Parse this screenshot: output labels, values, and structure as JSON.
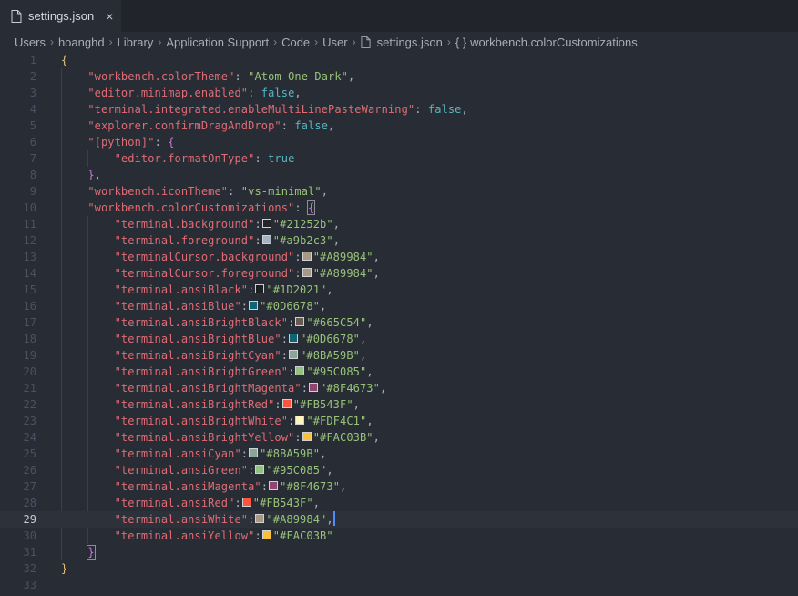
{
  "tab": {
    "title": "settings.json",
    "close": "×"
  },
  "breadcrumb": [
    "Users",
    "hoanghd",
    "Library",
    "Application Support",
    "Code",
    "User",
    "settings.json",
    "workbench.colorCustomizations"
  ],
  "breadcrumb_braces": "{ }",
  "current_line": 29,
  "lines": [
    {
      "n": "1",
      "ind": 0,
      "parts": [
        {
          "t": "{",
          "c": "brace1"
        }
      ]
    },
    {
      "n": "2",
      "ind": 1,
      "parts": [
        {
          "t": "\"workbench.colorTheme\"",
          "c": "key"
        },
        {
          "t": ": ",
          "c": "punc"
        },
        {
          "t": "\"Atom One Dark\"",
          "c": "str"
        },
        {
          "t": ",",
          "c": "punc"
        }
      ]
    },
    {
      "n": "3",
      "ind": 1,
      "parts": [
        {
          "t": "\"editor.minimap.enabled\"",
          "c": "key"
        },
        {
          "t": ": ",
          "c": "punc"
        },
        {
          "t": "false",
          "c": "bool"
        },
        {
          "t": ",",
          "c": "punc"
        }
      ]
    },
    {
      "n": "4",
      "ind": 1,
      "parts": [
        {
          "t": "\"terminal.integrated.enableMultiLinePasteWarning\"",
          "c": "key"
        },
        {
          "t": ": ",
          "c": "punc"
        },
        {
          "t": "false",
          "c": "bool"
        },
        {
          "t": ",",
          "c": "punc"
        }
      ]
    },
    {
      "n": "5",
      "ind": 1,
      "parts": [
        {
          "t": "\"explorer.confirmDragAndDrop\"",
          "c": "key"
        },
        {
          "t": ": ",
          "c": "punc"
        },
        {
          "t": "false",
          "c": "bool"
        },
        {
          "t": ",",
          "c": "punc"
        }
      ]
    },
    {
      "n": "6",
      "ind": 1,
      "parts": [
        {
          "t": "\"[python]\"",
          "c": "key"
        },
        {
          "t": ": ",
          "c": "punc"
        },
        {
          "t": "{",
          "c": "brace2"
        }
      ]
    },
    {
      "n": "7",
      "ind": 2,
      "parts": [
        {
          "t": "\"editor.formatOnType\"",
          "c": "key"
        },
        {
          "t": ": ",
          "c": "punc"
        },
        {
          "t": "true",
          "c": "bool"
        }
      ]
    },
    {
      "n": "8",
      "ind": 1,
      "parts": [
        {
          "t": "}",
          "c": "brace2"
        },
        {
          "t": ",",
          "c": "punc"
        }
      ]
    },
    {
      "n": "9",
      "ind": 1,
      "parts": [
        {
          "t": "\"workbench.iconTheme\"",
          "c": "key"
        },
        {
          "t": ": ",
          "c": "punc"
        },
        {
          "t": "\"vs-minimal\"",
          "c": "str"
        },
        {
          "t": ",",
          "c": "punc"
        }
      ]
    },
    {
      "n": "10",
      "ind": 1,
      "parts": [
        {
          "t": "\"workbench.colorCustomizations\"",
          "c": "key"
        },
        {
          "t": ": ",
          "c": "punc"
        },
        {
          "t": "{",
          "c": "brace2 match"
        }
      ]
    },
    {
      "n": "11",
      "ind": 2,
      "parts": [
        {
          "t": "\"terminal.background\"",
          "c": "key"
        },
        {
          "t": ":",
          "c": "punc"
        },
        {
          "sw": "#21252b"
        },
        {
          "t": "\"#21252b\"",
          "c": "str"
        },
        {
          "t": ",",
          "c": "punc"
        }
      ]
    },
    {
      "n": "12",
      "ind": 2,
      "parts": [
        {
          "t": "\"terminal.foreground\"",
          "c": "key"
        },
        {
          "t": ":",
          "c": "punc"
        },
        {
          "sw": "#a9b2c3"
        },
        {
          "t": "\"#a9b2c3\"",
          "c": "str"
        },
        {
          "t": ",",
          "c": "punc"
        }
      ]
    },
    {
      "n": "13",
      "ind": 2,
      "parts": [
        {
          "t": "\"terminalCursor.background\"",
          "c": "key"
        },
        {
          "t": ":",
          "c": "punc"
        },
        {
          "sw": "#A89984"
        },
        {
          "t": "\"#A89984\"",
          "c": "str"
        },
        {
          "t": ",",
          "c": "punc"
        }
      ]
    },
    {
      "n": "14",
      "ind": 2,
      "parts": [
        {
          "t": "\"terminalCursor.foreground\"",
          "c": "key"
        },
        {
          "t": ":",
          "c": "punc"
        },
        {
          "sw": "#A89984"
        },
        {
          "t": "\"#A89984\"",
          "c": "str"
        },
        {
          "t": ",",
          "c": "punc"
        }
      ]
    },
    {
      "n": "15",
      "ind": 2,
      "parts": [
        {
          "t": "\"terminal.ansiBlack\"",
          "c": "key"
        },
        {
          "t": ":",
          "c": "punc"
        },
        {
          "sw": "#1D2021"
        },
        {
          "t": "\"#1D2021\"",
          "c": "str"
        },
        {
          "t": ",",
          "c": "punc"
        }
      ]
    },
    {
      "n": "16",
      "ind": 2,
      "parts": [
        {
          "t": "\"terminal.ansiBlue\"",
          "c": "key"
        },
        {
          "t": ":",
          "c": "punc"
        },
        {
          "sw": "#0D6678"
        },
        {
          "t": "\"#0D6678\"",
          "c": "str"
        },
        {
          "t": ",",
          "c": "punc"
        }
      ]
    },
    {
      "n": "17",
      "ind": 2,
      "parts": [
        {
          "t": "\"terminal.ansiBrightBlack\"",
          "c": "key"
        },
        {
          "t": ":",
          "c": "punc"
        },
        {
          "sw": "#665C54"
        },
        {
          "t": "\"#665C54\"",
          "c": "str"
        },
        {
          "t": ",",
          "c": "punc"
        }
      ]
    },
    {
      "n": "18",
      "ind": 2,
      "parts": [
        {
          "t": "\"terminal.ansiBrightBlue\"",
          "c": "key"
        },
        {
          "t": ":",
          "c": "punc"
        },
        {
          "sw": "#0D6678"
        },
        {
          "t": "\"#0D6678\"",
          "c": "str"
        },
        {
          "t": ",",
          "c": "punc"
        }
      ]
    },
    {
      "n": "19",
      "ind": 2,
      "parts": [
        {
          "t": "\"terminal.ansiBrightCyan\"",
          "c": "key"
        },
        {
          "t": ":",
          "c": "punc"
        },
        {
          "sw": "#8BA59B"
        },
        {
          "t": "\"#8BA59B\"",
          "c": "str"
        },
        {
          "t": ",",
          "c": "punc"
        }
      ]
    },
    {
      "n": "20",
      "ind": 2,
      "parts": [
        {
          "t": "\"terminal.ansiBrightGreen\"",
          "c": "key"
        },
        {
          "t": ":",
          "c": "punc"
        },
        {
          "sw": "#95C085"
        },
        {
          "t": "\"#95C085\"",
          "c": "str"
        },
        {
          "t": ",",
          "c": "punc"
        }
      ]
    },
    {
      "n": "21",
      "ind": 2,
      "parts": [
        {
          "t": "\"terminal.ansiBrightMagenta\"",
          "c": "key"
        },
        {
          "t": ":",
          "c": "punc"
        },
        {
          "sw": "#8F4673"
        },
        {
          "t": "\"#8F4673\"",
          "c": "str"
        },
        {
          "t": ",",
          "c": "punc"
        }
      ]
    },
    {
      "n": "22",
      "ind": 2,
      "parts": [
        {
          "t": "\"terminal.ansiBrightRed\"",
          "c": "key"
        },
        {
          "t": ":",
          "c": "punc"
        },
        {
          "sw": "#FB543F"
        },
        {
          "t": "\"#FB543F\"",
          "c": "str"
        },
        {
          "t": ",",
          "c": "punc"
        }
      ]
    },
    {
      "n": "23",
      "ind": 2,
      "parts": [
        {
          "t": "\"terminal.ansiBrightWhite\"",
          "c": "key"
        },
        {
          "t": ":",
          "c": "punc"
        },
        {
          "sw": "#FDF4C1"
        },
        {
          "t": "\"#FDF4C1\"",
          "c": "str"
        },
        {
          "t": ",",
          "c": "punc"
        }
      ]
    },
    {
      "n": "24",
      "ind": 2,
      "parts": [
        {
          "t": "\"terminal.ansiBrightYellow\"",
          "c": "key"
        },
        {
          "t": ":",
          "c": "punc"
        },
        {
          "sw": "#FAC03B"
        },
        {
          "t": "\"#FAC03B\"",
          "c": "str"
        },
        {
          "t": ",",
          "c": "punc"
        }
      ]
    },
    {
      "n": "25",
      "ind": 2,
      "parts": [
        {
          "t": "\"terminal.ansiCyan\"",
          "c": "key"
        },
        {
          "t": ":",
          "c": "punc"
        },
        {
          "sw": "#8BA59B"
        },
        {
          "t": "\"#8BA59B\"",
          "c": "str"
        },
        {
          "t": ",",
          "c": "punc"
        }
      ]
    },
    {
      "n": "26",
      "ind": 2,
      "parts": [
        {
          "t": "\"terminal.ansiGreen\"",
          "c": "key"
        },
        {
          "t": ":",
          "c": "punc"
        },
        {
          "sw": "#95C085"
        },
        {
          "t": "\"#95C085\"",
          "c": "str"
        },
        {
          "t": ",",
          "c": "punc"
        }
      ]
    },
    {
      "n": "27",
      "ind": 2,
      "parts": [
        {
          "t": "\"terminal.ansiMagenta\"",
          "c": "key"
        },
        {
          "t": ":",
          "c": "punc"
        },
        {
          "sw": "#8F4673"
        },
        {
          "t": "\"#8F4673\"",
          "c": "str"
        },
        {
          "t": ",",
          "c": "punc"
        }
      ]
    },
    {
      "n": "28",
      "ind": 2,
      "parts": [
        {
          "t": "\"terminal.ansiRed\"",
          "c": "key"
        },
        {
          "t": ":",
          "c": "punc"
        },
        {
          "sw": "#FB543F"
        },
        {
          "t": "\"#FB543F\"",
          "c": "str"
        },
        {
          "t": ",",
          "c": "punc"
        }
      ]
    },
    {
      "n": "29",
      "ind": 2,
      "parts": [
        {
          "t": "\"terminal.ansiWhite\"",
          "c": "key"
        },
        {
          "t": ":",
          "c": "punc"
        },
        {
          "sw": "#A89984"
        },
        {
          "t": "\"#A89984\"",
          "c": "str"
        },
        {
          "t": ",",
          "c": "punc"
        },
        {
          "cursor": true
        }
      ]
    },
    {
      "n": "30",
      "ind": 2,
      "parts": [
        {
          "t": "\"terminal.ansiYellow\"",
          "c": "key"
        },
        {
          "t": ":",
          "c": "punc"
        },
        {
          "sw": "#FAC03B"
        },
        {
          "t": "\"#FAC03B\"",
          "c": "str"
        }
      ]
    },
    {
      "n": "31",
      "ind": 1,
      "parts": [
        {
          "t": "}",
          "c": "brace2 match"
        }
      ]
    },
    {
      "n": "32",
      "ind": 0,
      "parts": [
        {
          "t": "}",
          "c": "brace1"
        }
      ]
    },
    {
      "n": "33",
      "ind": 0,
      "parts": []
    }
  ],
  "colors": {
    "background": "#282c34",
    "tabbar": "#21252b",
    "key": "#e06c75",
    "string": "#98c379",
    "boolean": "#56b6c2",
    "cursor": "#528bff"
  }
}
